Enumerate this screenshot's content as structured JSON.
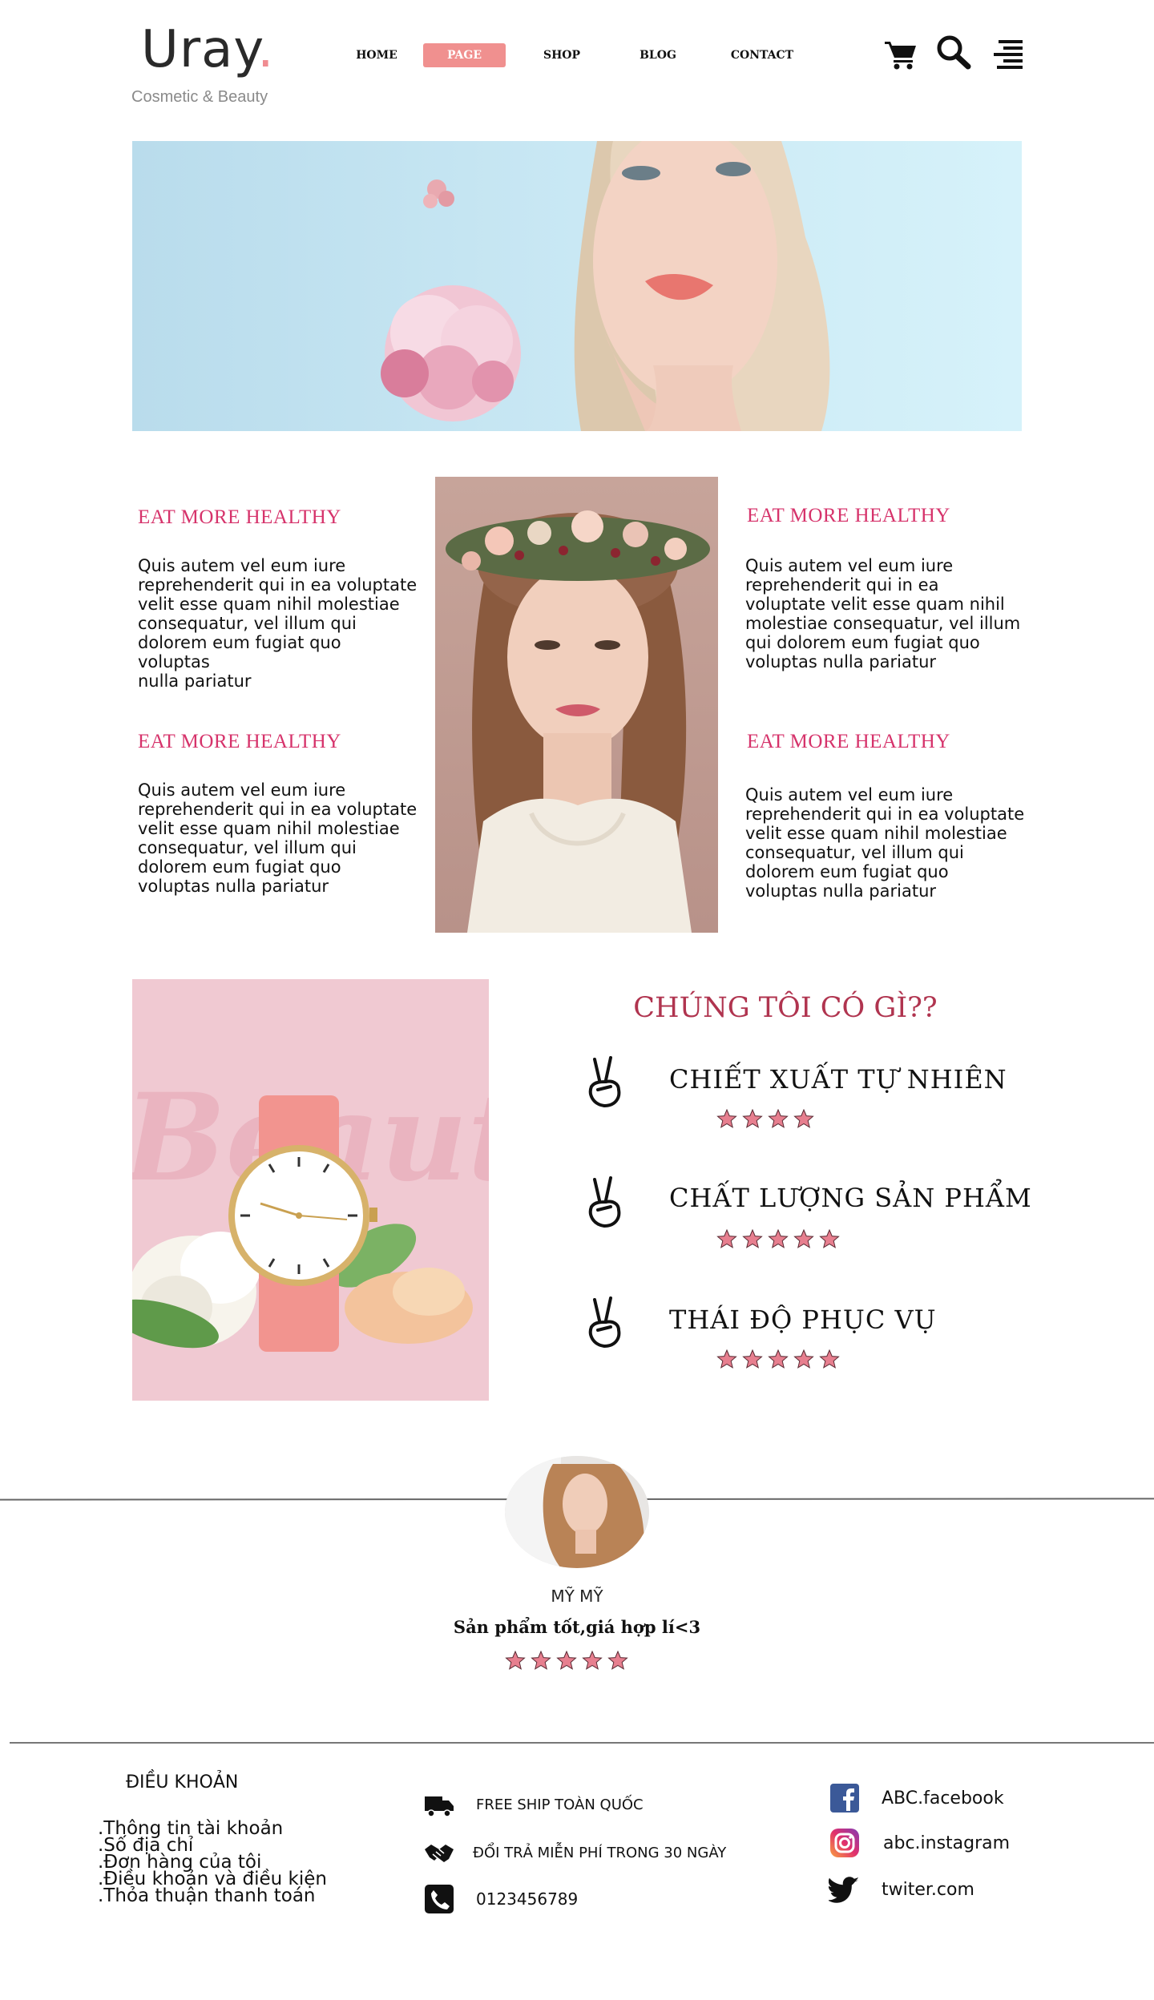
{
  "header": {
    "logo": "Uray",
    "logo_dot": ".",
    "tagline": "Cosmetic & Beauty",
    "nav": [
      {
        "label": "HOME"
      },
      {
        "label": "PAGE",
        "active": true
      },
      {
        "label": "SHOP"
      },
      {
        "label": "BLOG"
      },
      {
        "label": "CONTACT"
      }
    ],
    "icons": [
      "cart-icon",
      "search-icon",
      "menu-icon"
    ]
  },
  "features": [
    {
      "title": "EAT MORE HEALTHY",
      "text": "Quis autem vel eum iure\nreprehenderit qui in ea voluptate\nvelit esse quam nihil molestiae\nconsequatur, vel illum qui\ndolorem eum fugiat quo voluptas\nnulla pariatur"
    },
    {
      "title": "EAT MORE HEALTHY",
      "text": "Quis autem vel eum iure\nreprehenderit qui in ea\nvoluptate velit esse quam nihil\nmolestiae consequatur, vel illum\nqui dolorem eum fugiat quo\nvoluptas nulla pariatur"
    },
    {
      "title": "EAT MORE HEALTHY",
      "text": "Quis autem vel eum iure\nreprehenderit qui in ea voluptate\nvelit esse quam nihil molestiae\nconsequatur, vel illum qui\ndolorem eum fugiat quo\nvoluptas nulla pariatur"
    },
    {
      "title": "EAT MORE HEALTHY",
      "text": "Quis autem vel eum iure\nreprehenderit qui in ea voluptate\nvelit esse quam nihil molestiae\nconsequatur, vel illum qui\ndolorem eum fugiat quo\nvoluptas nulla pariatur"
    }
  ],
  "offers": {
    "heading": "CHÚNG TÔI CÓ GÌ??",
    "watch_watermark": "Beauty",
    "items": [
      {
        "title": "CHIẾT XUẤT TỰ NHIÊN",
        "rating": 4,
        "icon": "peace-hand-icon"
      },
      {
        "title": "CHẤT LƯỢNG SẢN PHẨM",
        "rating": 5,
        "icon": "peace-hand-icon"
      },
      {
        "title": "THÁI ĐỘ PHỤC VỤ",
        "rating": 5,
        "icon": "peace-hand-icon"
      }
    ]
  },
  "testimonial": {
    "name": "MỸ MỸ",
    "quote": "Sản phẩm tốt,giá hợp lí<3",
    "rating": 5
  },
  "footer": {
    "terms_title": "ĐIỀU KHOẢN",
    "terms": [
      ".Thông tin tài khoản",
      ".Số địa chỉ",
      ".Đơn hàng của tôi",
      ".Điều khoản và điều kiện",
      ".Thỏa thuận thanh toán"
    ],
    "services": [
      {
        "icon": "truck-icon",
        "text": "FREE SHIP TOÀN QUỐC"
      },
      {
        "icon": "handshake-icon",
        "text": "ĐỔI TRẢ MIỄN PHÍ TRONG 30 NGÀY"
      },
      {
        "icon": "phone-icon",
        "text": "0123456789"
      }
    ],
    "social": [
      {
        "icon": "facebook-icon",
        "text": "ABC.facebook",
        "color": "#3b5998"
      },
      {
        "icon": "instagram-icon",
        "text": "abc.instagram",
        "color": "#c13584"
      },
      {
        "icon": "twitter-icon",
        "text": "twiter.com",
        "color": "#111111"
      }
    ]
  },
  "colors": {
    "accent_pink": "#f0908f",
    "feature_title": "#d6336b",
    "heading_red": "#b0344f",
    "star_fill": "#e77f8f"
  }
}
